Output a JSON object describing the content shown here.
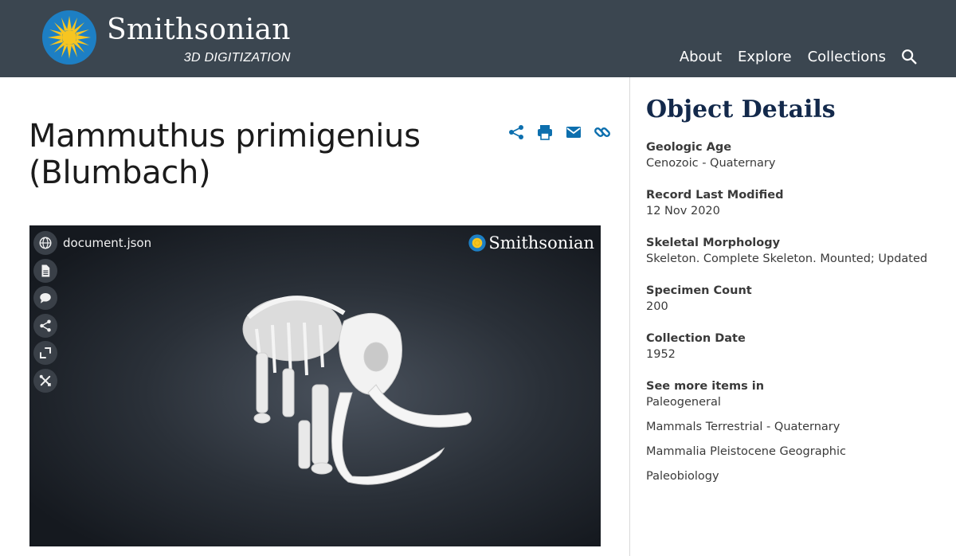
{
  "header": {
    "brand_name": "Smithsonian",
    "brand_sub": "3D DIGITIZATION",
    "nav": [
      {
        "label": "About"
      },
      {
        "label": "Explore"
      },
      {
        "label": "Collections"
      }
    ],
    "brand_color": "#3b4650",
    "sun_color": "#f7c520"
  },
  "page": {
    "title": "Mammuthus primigenius (Blumbach)",
    "action_icons": [
      "share-icon",
      "print-icon",
      "email-icon",
      "link-icon"
    ],
    "action_icon_color": "#0d6fae"
  },
  "viewer": {
    "document_label": "document.json",
    "brand_text": "Smithsonian",
    "tools": [
      "globe-icon",
      "document-icon",
      "comment-icon",
      "share-icon",
      "fullscreen-icon",
      "tools-icon"
    ]
  },
  "details": {
    "heading": "Object Details",
    "items": [
      {
        "label": "Geologic Age",
        "value": "Cenozoic - Quaternary"
      },
      {
        "label": "Record Last Modified",
        "value": "12 Nov 2020"
      },
      {
        "label": "Skeletal Morphology",
        "value": "Skeleton. Complete Skeleton. Mounted; Updated"
      },
      {
        "label": "Specimen Count",
        "value": "200"
      },
      {
        "label": "Collection Date",
        "value": "1952"
      }
    ],
    "more_label": "See more items in",
    "more_links": [
      "Paleogeneral",
      "Mammals Terrestrial - Quaternary",
      "Mammalia Pleistocene Geographic",
      "Paleobiology"
    ],
    "heading_color": "#13294b"
  }
}
